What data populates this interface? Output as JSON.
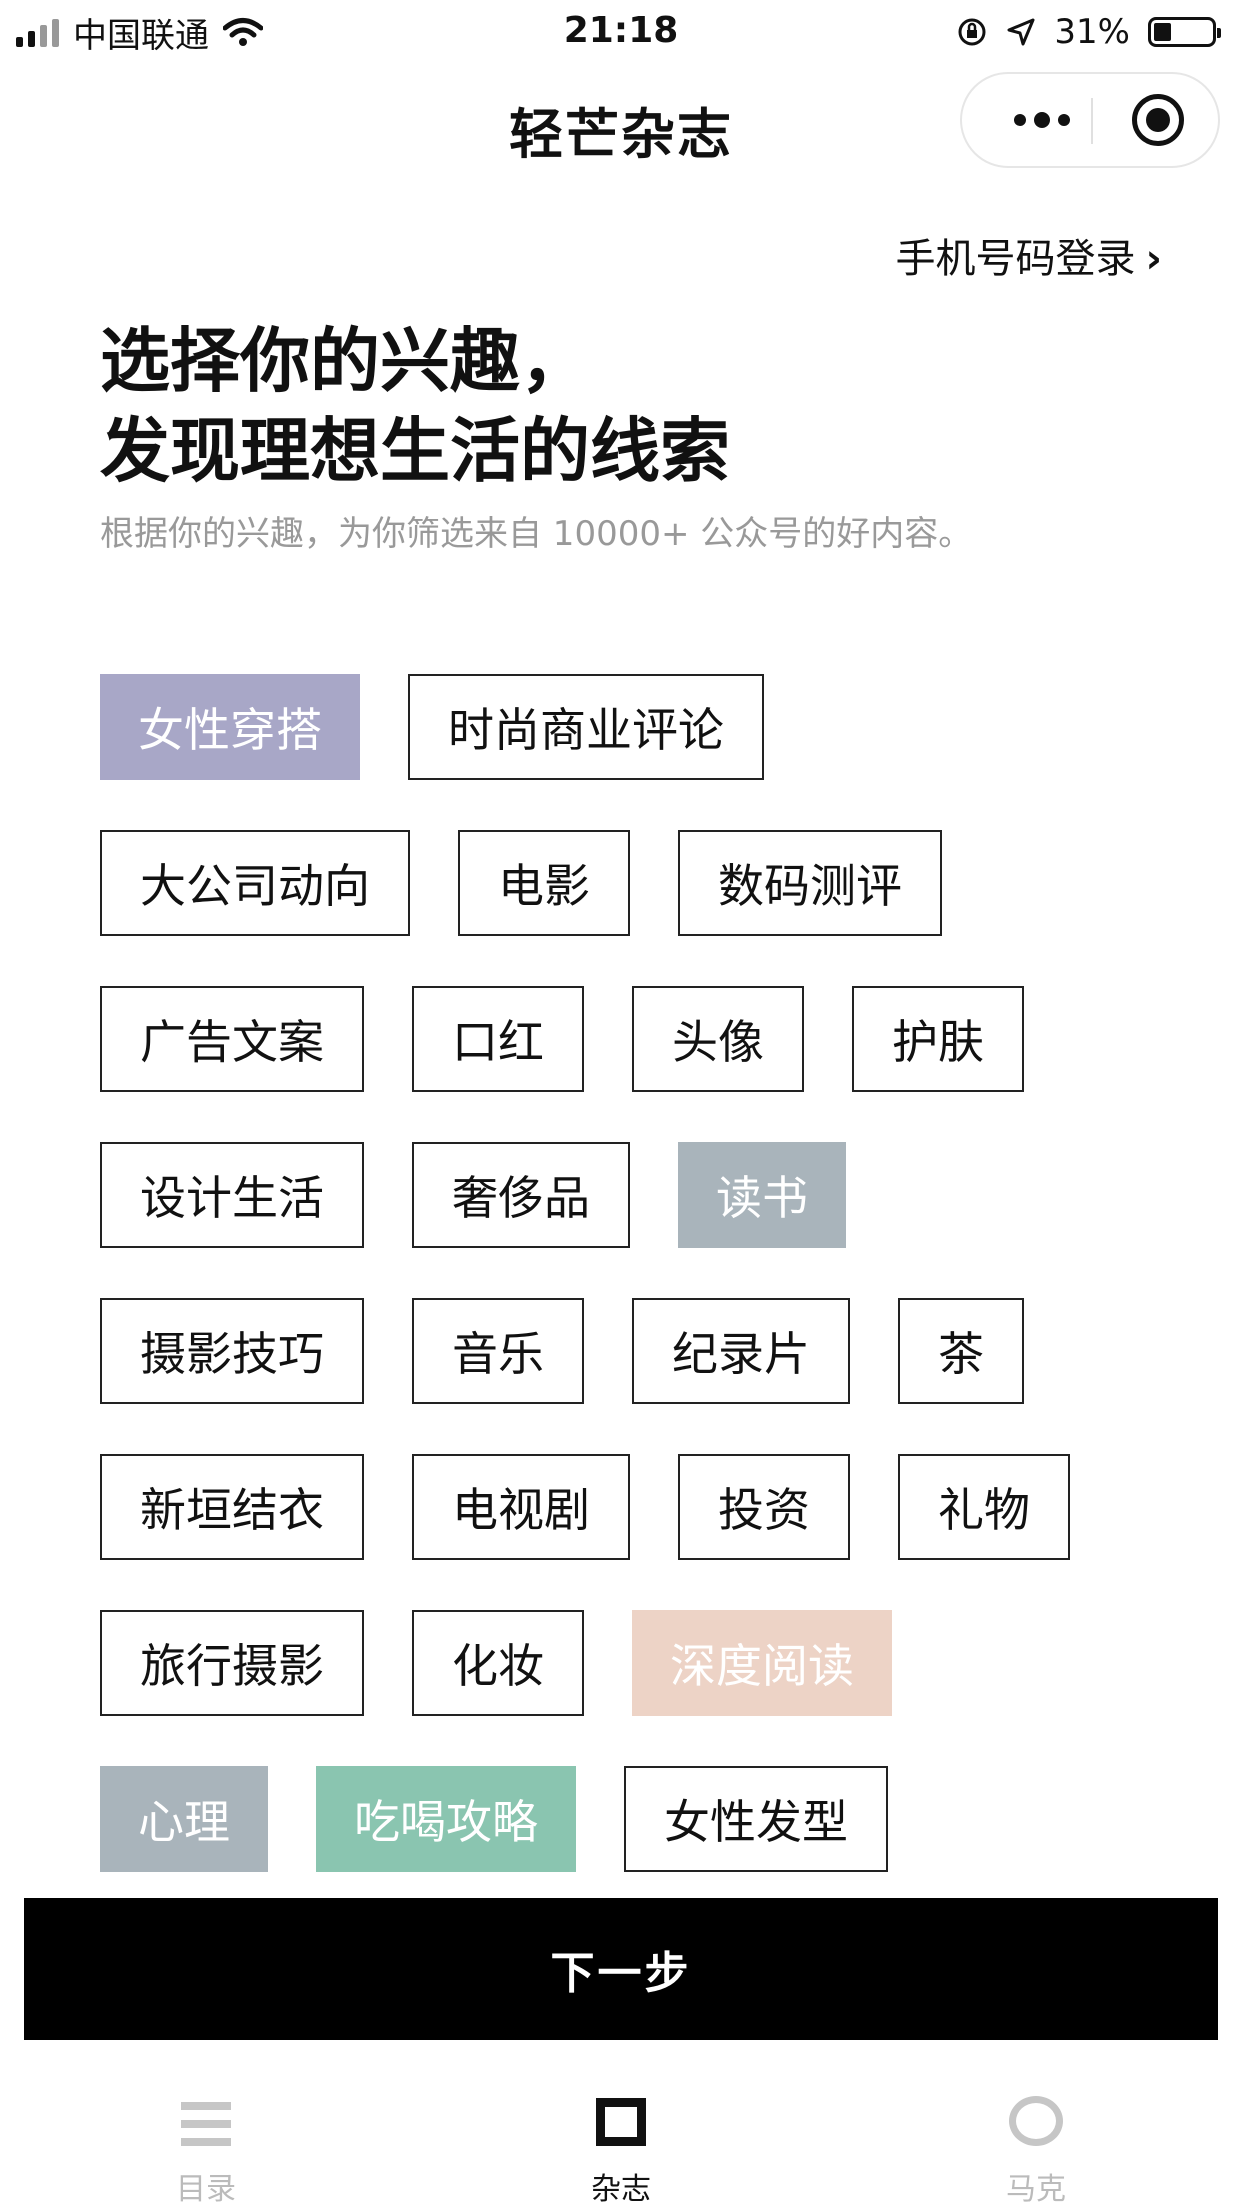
{
  "status_bar": {
    "carrier": "中国联通",
    "time": "21:18",
    "battery": "31%",
    "battery_level": 0.31,
    "signal_bars_on": 2,
    "signal_bars_total": 4,
    "icons": [
      "signal-icon",
      "wifi-icon",
      "rotation-lock-icon",
      "location-icon",
      "battery-icon"
    ]
  },
  "nav": {
    "title": "轻芒杂志",
    "more_icon": "more-dots-icon",
    "close_icon": "target-icon"
  },
  "phone_login": {
    "label": "手机号码登录",
    "chevron": "›"
  },
  "heading": {
    "line1": "选择你的兴趣，",
    "line2": "发现理想生活的线索"
  },
  "subtitle": "根据你的兴趣，为你筛选来自 10000+ 公众号的好内容。",
  "tag_rows": [
    [
      {
        "label": "女性穿搭",
        "selected": true,
        "color": "#a8a7c7"
      },
      {
        "label": "时尚商业评论",
        "selected": false
      }
    ],
    [
      {
        "label": "大公司动向",
        "selected": false
      },
      {
        "label": "电影",
        "selected": false
      },
      {
        "label": "数码测评",
        "selected": false
      }
    ],
    [
      {
        "label": "广告文案",
        "selected": false
      },
      {
        "label": "口红",
        "selected": false
      },
      {
        "label": "头像",
        "selected": false
      },
      {
        "label": "护肤",
        "selected": false
      }
    ],
    [
      {
        "label": "设计生活",
        "selected": false
      },
      {
        "label": "奢侈品",
        "selected": false
      },
      {
        "label": "读书",
        "selected": true,
        "color": "#a9b4bb"
      }
    ],
    [
      {
        "label": "摄影技巧",
        "selected": false
      },
      {
        "label": "音乐",
        "selected": false
      },
      {
        "label": "纪录片",
        "selected": false
      },
      {
        "label": "茶",
        "selected": false
      }
    ],
    [
      {
        "label": "新垣结衣",
        "selected": false
      },
      {
        "label": "电视剧",
        "selected": false
      },
      {
        "label": "投资",
        "selected": false
      },
      {
        "label": "礼物",
        "selected": false
      }
    ],
    [
      {
        "label": "旅行摄影",
        "selected": false
      },
      {
        "label": "化妆",
        "selected": false
      },
      {
        "label": "深度阅读",
        "selected": true,
        "color": "#edd3c6"
      }
    ],
    [
      {
        "label": "心理",
        "selected": true,
        "color": "#a9b4bb"
      },
      {
        "label": "吃喝攻略",
        "selected": true,
        "color": "#8ac5b0"
      },
      {
        "label": "女性发型",
        "selected": false
      }
    ]
  ],
  "next_button": "下一步",
  "tabs": [
    {
      "label": "目录",
      "icon": "list-icon",
      "active": false
    },
    {
      "label": "杂志",
      "icon": "square-icon",
      "active": true
    },
    {
      "label": "马克",
      "icon": "circle-icon",
      "active": false
    }
  ]
}
